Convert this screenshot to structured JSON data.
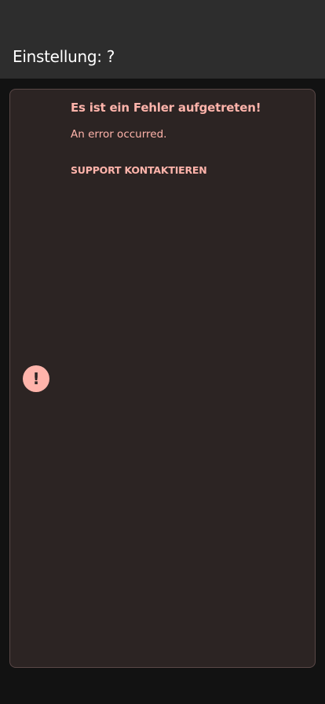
{
  "header": {
    "title": "Einstellung: ?"
  },
  "error": {
    "icon": "!",
    "title": "Es ist ein Fehler aufgetreten!",
    "message": "An error occurred.",
    "support_label": "SUPPORT KONTAKTIEREN"
  },
  "colors": {
    "accent": "#ffb4ab",
    "header_bg": "#2d2d2d",
    "card_bg": "#2c2423"
  }
}
